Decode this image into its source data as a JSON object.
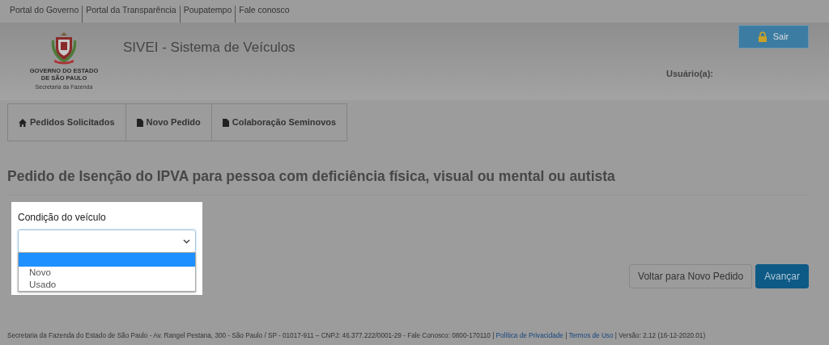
{
  "top_links": [
    "Portal do Governo",
    "Portal da Transparência",
    "Poupatempo",
    "Fale conosco"
  ],
  "header": {
    "logo_lines": [
      "GOVERNO DO ESTADO",
      "DE SÃO PAULO"
    ],
    "logo_subtitle": "Secretaria da Fazenda",
    "title": "SIVEI - Sistema de Veículos",
    "logout_button": "Sair",
    "user_label": "Usuário(a):"
  },
  "nav_tabs": [
    {
      "label": "Pedidos Solicitados",
      "kind": "home"
    },
    {
      "label": "Novo Pedido",
      "kind": "document"
    },
    {
      "label": "Colaboração Seminovos",
      "kind": "document"
    }
  ],
  "page_title": "Pedido de Isenção do IPVA para pessoa com deficiência física, visual ou mental ou autista",
  "vehicle_condition": {
    "label": "Condição do veículo",
    "options": [
      {
        "selected": true
      },
      {
        "label": "Novo",
        "selected": false
      },
      {
        "label": "Usado",
        "selected": false
      }
    ]
  },
  "buttons": [
    {
      "label": "Voltar para Novo Pedido",
      "kind": "secondary"
    },
    {
      "label": "Avançar",
      "kind": "primary"
    }
  ],
  "footer": [
    {
      "kind": "text",
      "text": "Secretaria da Fazenda do Estado de São Paulo - Av. Rangel Pestana, 300 - São Paulo / SP - 01017-911 – CNPJ: 46.377.222/0001-29 - Fale Conosco: 0800-170110 |"
    },
    {
      "kind": "link",
      "text": "Política de Privacidade"
    },
    {
      "kind": "text",
      "text": "|"
    },
    {
      "kind": "link",
      "text": "Termos de Uso"
    },
    {
      "kind": "text",
      "text": "| Versão: 2.12 (16-12-2020.01)"
    }
  ]
}
